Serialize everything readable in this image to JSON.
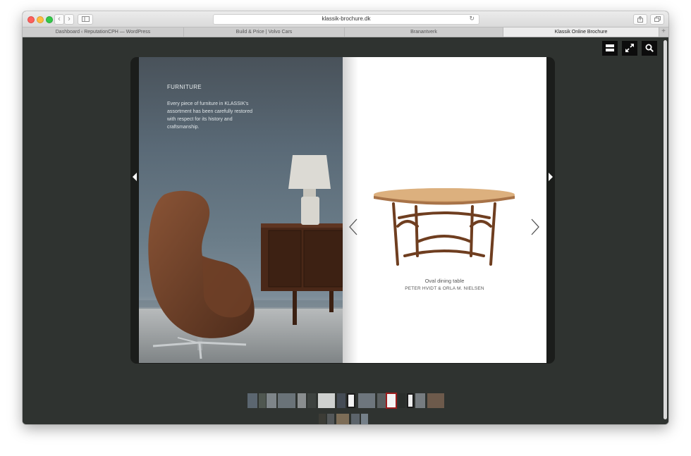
{
  "browser": {
    "url": "klassik-brochure.dk",
    "tabs": [
      {
        "label": "Dashboard ‹ ReputationCPH — WordPress"
      },
      {
        "label": "Build & Price | Volvo Cars"
      },
      {
        "label": "Branantverk"
      },
      {
        "label": "Klassik Online Brochure",
        "active": true
      }
    ]
  },
  "viewer_tools": [
    {
      "name": "toc-icon"
    },
    {
      "name": "fullscreen-icon"
    },
    {
      "name": "search-icon"
    }
  ],
  "left_page": {
    "heading": "FURNITURE",
    "body": "Every piece of furniture in KLASSIK's assortment has been carefully restored with respect for its history and craftsmanship."
  },
  "right_page": {
    "product_name": "Oval dining table",
    "designer": "PETER HVIDT & ORLA M. NIELSEN"
  },
  "thumbnails": {
    "count": 22,
    "selected_index": 11
  },
  "colors": {
    "viewer_background": "#2f3330",
    "selected_thumbnail_outline": "#9b1c1c"
  }
}
